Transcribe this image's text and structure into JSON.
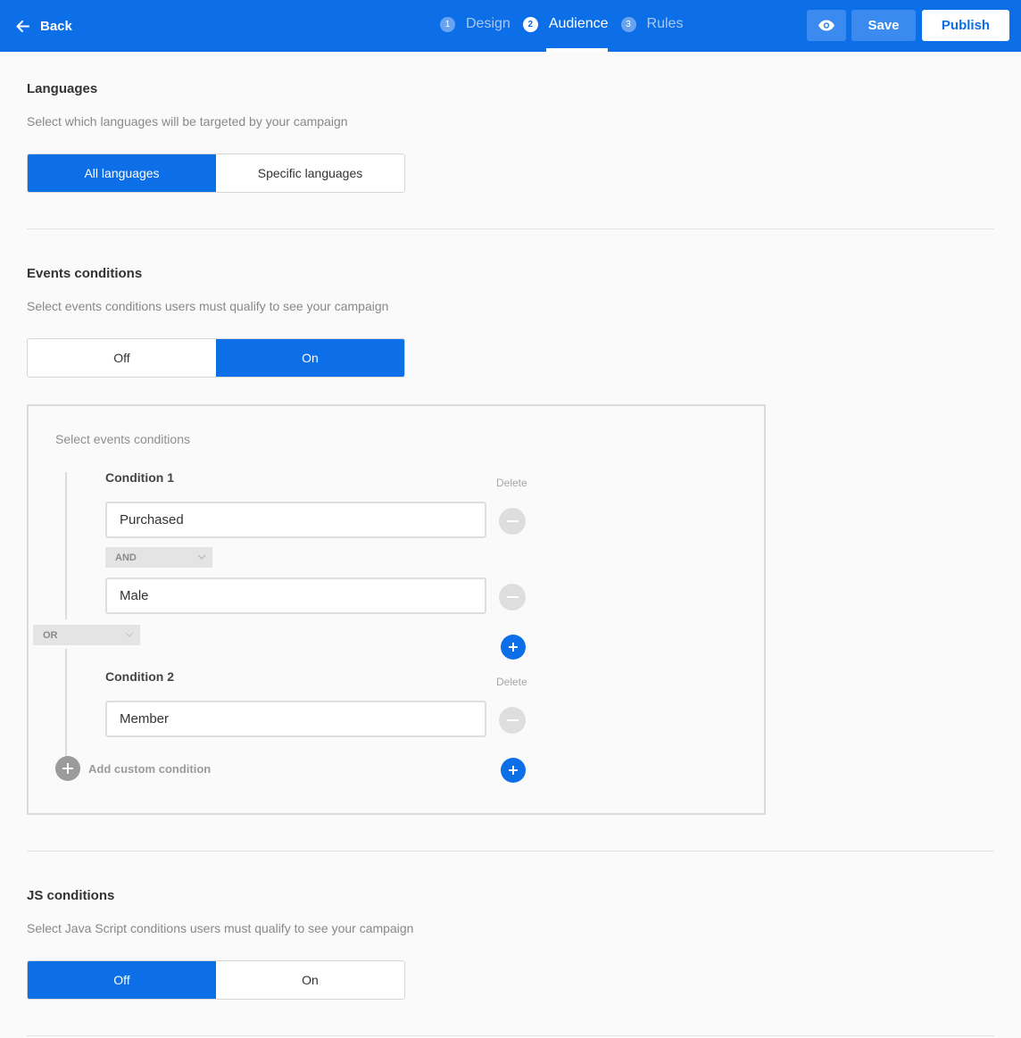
{
  "topbar": {
    "back_label": "Back",
    "steps": [
      {
        "num": "1",
        "label": "Design"
      },
      {
        "num": "2",
        "label": "Audience"
      },
      {
        "num": "3",
        "label": "Rules"
      }
    ],
    "active_step": "Audience",
    "preview_icon": "eye-icon",
    "save_label": "Save",
    "publish_label": "Publish",
    "accent_color": "#0d6fe8"
  },
  "languages": {
    "title": "Languages",
    "subtitle": "Select which languages will be targeted by your campaign",
    "options": [
      "All languages",
      "Specific languages"
    ],
    "selected": "All languages"
  },
  "events": {
    "title": "Events conditions",
    "subtitle": "Select events conditions users must qualify to see your campaign",
    "options": [
      "Off",
      "On"
    ],
    "selected": "On",
    "box_label": "Select events conditions",
    "delete_label": "Delete",
    "conditions": [
      {
        "title": "Condition 1",
        "values": [
          "Purchased",
          "Male"
        ],
        "joiner": "AND"
      },
      {
        "title": "Condition 2",
        "values": [
          "Member"
        ]
      }
    ],
    "group_joiner": "OR",
    "add_custom_label": "Add custom condition"
  },
  "js": {
    "title": "JS conditions",
    "subtitle": "Select Java Script conditions users must qualify to see your campaign",
    "options": [
      "Off",
      "On"
    ],
    "selected": "Off"
  }
}
